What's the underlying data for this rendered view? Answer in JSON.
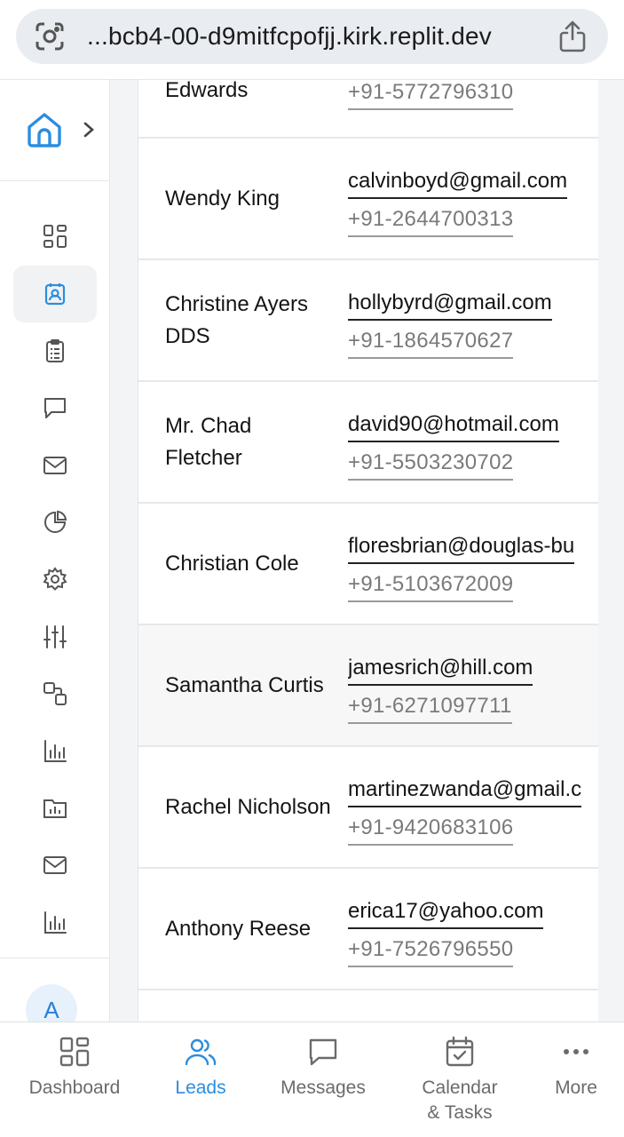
{
  "browser": {
    "url": "...bcb4-00-d9mitfcpofjj.kirk.replit.dev"
  },
  "colors": {
    "accent": "#2b8de0",
    "sidebar_active_bg": "#f1f2f4",
    "text_muted": "#7a7a7a"
  },
  "sidebar": {
    "home_icon": "home-icon",
    "expand_icon": "chevron-right-icon",
    "items": [
      {
        "icon": "dashboard-icon",
        "active": false
      },
      {
        "icon": "contacts-icon",
        "active": true
      },
      {
        "icon": "clipboard-icon",
        "active": false
      },
      {
        "icon": "chat-icon",
        "active": false
      },
      {
        "icon": "mail-icon",
        "active": false
      },
      {
        "icon": "pie-chart-icon",
        "active": false
      },
      {
        "icon": "settings-icon",
        "active": false
      },
      {
        "icon": "sliders-icon",
        "active": false
      },
      {
        "icon": "integrations-icon",
        "active": false
      },
      {
        "icon": "bar-chart-icon",
        "active": false
      },
      {
        "icon": "folder-chart-icon",
        "active": false
      },
      {
        "icon": "mail-icon",
        "active": false
      },
      {
        "icon": "bar-chart-icon",
        "active": false
      }
    ],
    "avatar_initial": "A"
  },
  "leads": [
    {
      "name": "Edwards",
      "email": "",
      "phone": "+91-5772796310"
    },
    {
      "name": "Wendy King",
      "email": "calvinboyd@gmail.com",
      "phone": "+91-2644700313"
    },
    {
      "name": "Christine Ayers DDS",
      "email": "hollybyrd@gmail.com",
      "phone": "+91-1864570627"
    },
    {
      "name": "Mr. Chad Fletcher",
      "email": "david90@hotmail.com",
      "phone": "+91-5503230702"
    },
    {
      "name": "Christian Cole",
      "email": "floresbrian@douglas-bu",
      "phone": "+91-5103672009"
    },
    {
      "name": "Samantha Curtis",
      "email": "jamesrich@hill.com",
      "phone": "+91-6271097711"
    },
    {
      "name": "Rachel Nicholson",
      "email": "martinezwanda@gmail.c",
      "phone": "+91-9420683106"
    },
    {
      "name": "Anthony Reese",
      "email": "erica17@yahoo.com",
      "phone": "+91-7526796550"
    }
  ],
  "bottom_nav": {
    "dashboard": "Dashboard",
    "leads": "Leads",
    "messages": "Messages",
    "calendar_line1": "Calendar",
    "calendar_line2": "& Tasks",
    "more": "More"
  }
}
